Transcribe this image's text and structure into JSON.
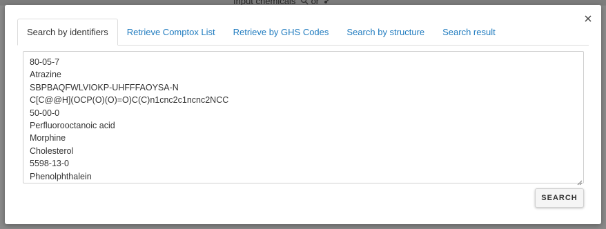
{
  "backdrop": {
    "input_chemicals_label": "Input chemicals",
    "or_label": "or",
    "search_icon": "magnifier-icon",
    "structure_icon": "molecule-icon"
  },
  "dialog": {
    "close_icon": "close-icon",
    "tabs": [
      {
        "label": "Search by identifiers",
        "active": true
      },
      {
        "label": "Retrieve Comptox List",
        "active": false
      },
      {
        "label": "Retrieve by GHS Codes",
        "active": false
      },
      {
        "label": "Search by structure",
        "active": false
      },
      {
        "label": "Search result",
        "active": false
      }
    ],
    "identifiers_input": {
      "lines": [
        "80-05-7",
        "Atrazine",
        "SBPBAQFWLVIOKP-UHFFFAOYSA-N",
        "C[C@@H](OCP(O)(O)=O)C(C)n1cnc2c1ncnc2NCC",
        "50-00-0",
        "Perfluorooctanoic acid",
        "Morphine",
        "Cholesterol",
        "5598-13-0",
        "Phenolphthalein"
      ]
    },
    "search_button_label": "SEARCH"
  },
  "colors": {
    "tab_link": "#1f7bbf",
    "backdrop": "#8a8a8a"
  }
}
